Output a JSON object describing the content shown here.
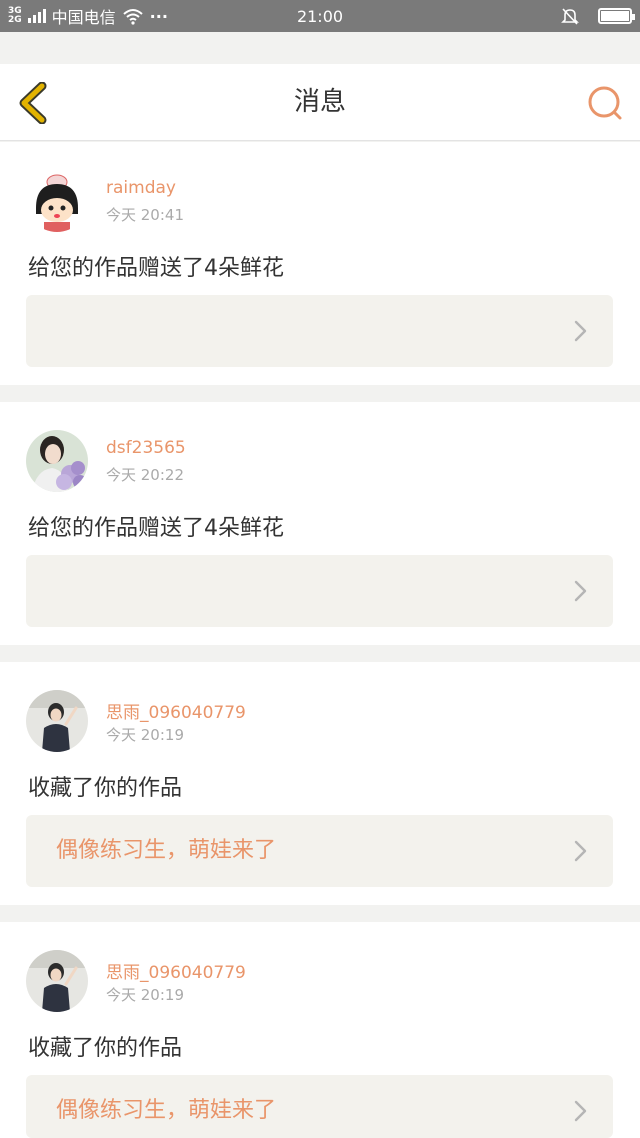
{
  "status_bar": {
    "network_top": "3G",
    "network_bottom": "2G",
    "carrier": "中国电信",
    "more": "···",
    "time": "21:00"
  },
  "header": {
    "title": "消息"
  },
  "colors": {
    "accent": "#e9956a",
    "back_icon": "#e2b300",
    "card_bg": "#ffffff",
    "work_bg": "#f3f2ed"
  },
  "messages": [
    {
      "username": "raimday",
      "time": "今天 20:41",
      "text": "给您的作品赠送了4朵鲜花",
      "work_title": ""
    },
    {
      "username": "dsf23565",
      "time": "今天 20:22",
      "text": "给您的作品赠送了4朵鲜花",
      "work_title": ""
    },
    {
      "username": "思雨_096040779",
      "time": "今天 20:19",
      "text": "收藏了你的作品",
      "work_title": "偶像练习生，萌娃来了"
    },
    {
      "username": "思雨_096040779",
      "time": "今天 20:19",
      "text": "收藏了你的作品",
      "work_title": "偶像练习生，萌娃来了"
    }
  ]
}
